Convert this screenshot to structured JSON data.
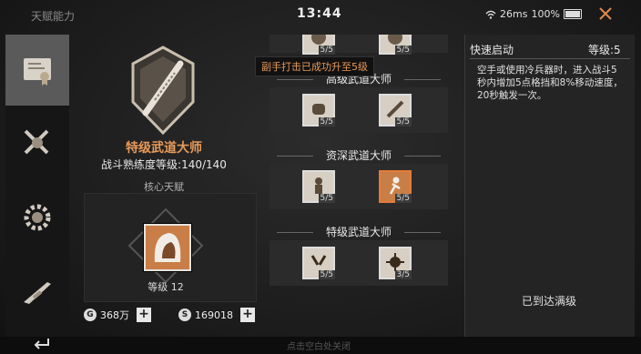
{
  "header": {
    "title": "天赋能力",
    "clock": "13:44",
    "network": "26ms",
    "battery": "100%",
    "close_icon": "close-icon"
  },
  "tabs": [
    {
      "icon": "certificate-icon",
      "active": true
    },
    {
      "icon": "crossed-swords-icon",
      "active": false
    },
    {
      "icon": "gear-shield-icon",
      "active": false
    },
    {
      "icon": "rifle-icon",
      "active": false
    }
  ],
  "profile": {
    "rank_name": "特级武道大师",
    "mastery": "战斗熟练度等级:140/140",
    "core_label": "核心天赋",
    "core_level": "等级 12"
  },
  "currency": {
    "gold": "368万",
    "silver": "169018"
  },
  "tooltip": "副手打击已成功升至5级",
  "tree": {
    "tiers": [
      {
        "name": "",
        "skills": [
          {
            "level": "5/5"
          },
          {
            "level": "5/5"
          }
        ]
      },
      {
        "name": "高级武道大师",
        "skills": [
          {
            "level": "5/5"
          },
          {
            "level": "5/5"
          }
        ]
      },
      {
        "name": "资深武道大师",
        "skills": [
          {
            "level": "5/5"
          },
          {
            "level": "5/5"
          }
        ]
      },
      {
        "name": "特级武道大师",
        "skills": [
          {
            "level": "5/5"
          },
          {
            "level": "3/5"
          }
        ]
      }
    ]
  },
  "detail": {
    "title": "快速启动",
    "level": "等级:5",
    "description": "空手或使用冷兵器时，进入战斗5秒内增加5点格挡和8%移动速度，20秒触发一次。",
    "status": "已到达满级"
  },
  "footer": {
    "hint": "点击空白处关闭"
  },
  "colors": {
    "accent": "#e57a3a",
    "rank": "#e89a5a"
  }
}
